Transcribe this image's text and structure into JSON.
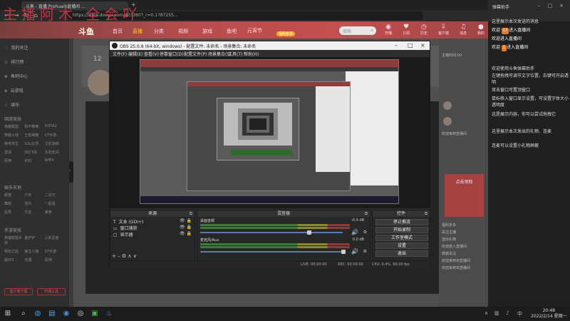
{
  "browser": {
    "tab_title": "斗鱼 - 直播 Prohuaih直播间 ...",
    "url": "https://www.douyu.com/403360?_r=0.1787255...",
    "new_tab": "+"
  },
  "watermark": "主播阿木 全会吖",
  "header": {
    "logo": "斗鱼",
    "nav": [
      "首页",
      "直播",
      "分类",
      "视频",
      "游戏",
      "鱼吧"
    ],
    "yuanxiao": "元宵节",
    "yuanxiao_badge": "福利多多",
    "search_placeholder": "搜索",
    "icons": [
      {
        "label": "开播",
        "icon": "camera-icon"
      },
      {
        "label": "订阅",
        "icon": "heart-icon"
      },
      {
        "label": "历史",
        "icon": "clock-icon"
      },
      {
        "label": "客户端",
        "icon": "download-icon"
      },
      {
        "label": "消息",
        "icon": "bell-icon"
      },
      {
        "label": "我的",
        "icon": "user-icon"
      }
    ]
  },
  "sidebar": {
    "items": [
      {
        "label": "我的关注",
        "icon": "heart-icon"
      },
      {
        "label": "排行榜",
        "icon": "trophy-icon"
      },
      {
        "label": "鱼吧中心",
        "icon": "fish-icon"
      },
      {
        "label": "云游戏",
        "icon": "game-icon"
      },
      {
        "label": "娱乐",
        "icon": "star-icon"
      }
    ],
    "section1": "网游竞技",
    "grid1": [
      "英雄联盟",
      "和平精英",
      "DOTA2",
      "穿越火线",
      "王者荣耀",
      "CF手游",
      "绝地求生",
      "LOL云顶",
      "主机游戏",
      "逆战",
      "QQ飞车",
      "永劫无间",
      "原神",
      "炉石",
      "APEX"
    ],
    "section2": "娱乐天地",
    "grid2": [
      "颜值",
      "户外",
      "二次元",
      "舞蹈",
      "音乐",
      "一起看",
      "星秀",
      "交友",
      "美食"
    ],
    "section3": "手游竞技",
    "grid3": [
      "英雄联盟手游",
      "金铲铲",
      "火影忍者",
      "明日之后",
      "第五人格",
      "CF手游",
      "崩坏3",
      "光遇",
      "原神"
    ],
    "btn_left": "客户端下载",
    "btn_right": "开播工具"
  },
  "room": {
    "number": "12"
  },
  "chat": {
    "lines": [
      "主播时间:00",
      "欢迎来到直播间",
      "福利多多",
      "关注主播",
      "送出礼物",
      "欢迎进入直播间",
      "感谢关注",
      "欢迎来到本直播间",
      "欢迎来到本直播间"
    ],
    "promo": "点击领取"
  },
  "obs": {
    "title": "OBS 25.0.8 (64-bit, windows) - 配置文件: 未命名 - 场景集合: 未命名",
    "menu": [
      "文件(F)",
      "编辑(E)",
      "查看(V)",
      "停靠窗口(D)",
      "配置文件(P)",
      "场景集合(S)",
      "工具(T)",
      "帮助(H)"
    ],
    "docks": {
      "sources_title": "来源",
      "mixer_title": "混音器",
      "controls_title": "控件"
    },
    "sources": [
      {
        "icon": "T",
        "label": "文本 (GDI+)"
      },
      {
        "icon": "▭",
        "label": "窗口捕获"
      },
      {
        "icon": "▢",
        "label": "显示器"
      }
    ],
    "mixer": [
      {
        "name": "桌面音频",
        "db": "-6.9 dB"
      },
      {
        "name": "麦克风/Aux",
        "db": "0.0 dB"
      }
    ],
    "controls": [
      "停止推流",
      "开始录制",
      "工作室模式",
      "设置",
      "退出"
    ],
    "status": {
      "live": "LIVE: 00:00:00",
      "rec": "REC: 00:00:00",
      "cpu": "CPU: 0.4%, 60.00 fps",
      "bitrate": "kb/s: 2469"
    }
  },
  "notify": {
    "title": "弹幕助手",
    "messages": [
      {
        "text": "这里展示本次发送的消息",
        "hl": false
      },
      {
        "text": "欢迎 ",
        "badge": "17",
        "suffix": "进入直播间",
        "hl": true
      },
      {
        "text": "欢迎进入直播间",
        "hl": true
      },
      {
        "text": "欢迎 ",
        "badge": "1",
        "suffix": "进入直播间",
        "hl": true
      },
      {
        "text": "欢迎使用斗鱼弹幕助手",
        "hl": false
      },
      {
        "text": "左键拖拽可调节文字位置，右键可开启透明",
        "hl": false
      },
      {
        "text": "双击窗口可置顶窗口",
        "hl": false
      },
      {
        "text": "鼠标移入窗口显示设置，可设置字体大小透明度",
        "hl": false
      },
      {
        "text": "这是展示内容，你可以尝试拖拽它",
        "hl": false
      },
      {
        "text": "这里展示本次发出的礼物、连麦",
        "hl": false
      },
      {
        "text": "连麦可以设置小礼物屏蔽",
        "hl": false
      }
    ]
  },
  "taskbar": {
    "time": "20:48",
    "date": "2022/2/14 星期一"
  }
}
